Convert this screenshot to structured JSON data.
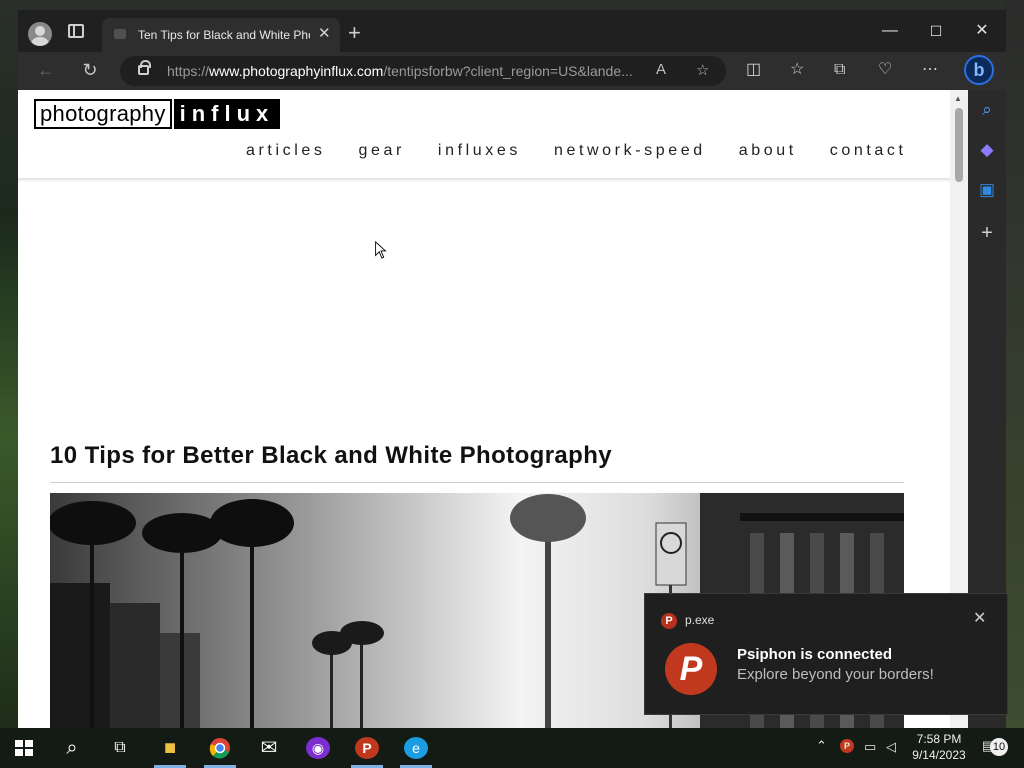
{
  "browser": {
    "tab_title": "Ten Tips for Black and White Pho",
    "url_scheme": "https://",
    "url_host": "www.photographyinflux.com",
    "url_path": "/tentipsforbw?client_region=US&lande..."
  },
  "site": {
    "logo_part1": "photography",
    "logo_part2": "influx",
    "nav": [
      "articles",
      "gear",
      "influxes",
      "network-speed",
      "about",
      "contact"
    ]
  },
  "article": {
    "title": "10 Tips for Better Black and White Photography"
  },
  "toast": {
    "app": "p.exe",
    "title": "Psiphon is connected",
    "body": "Explore beyond your borders!"
  },
  "taskbar": {
    "time": "7:58 PM",
    "date": "9/14/2023",
    "notification_count": "10"
  },
  "colors": {
    "accent": "#2b6fe0",
    "psiphon": "#c0391f"
  }
}
